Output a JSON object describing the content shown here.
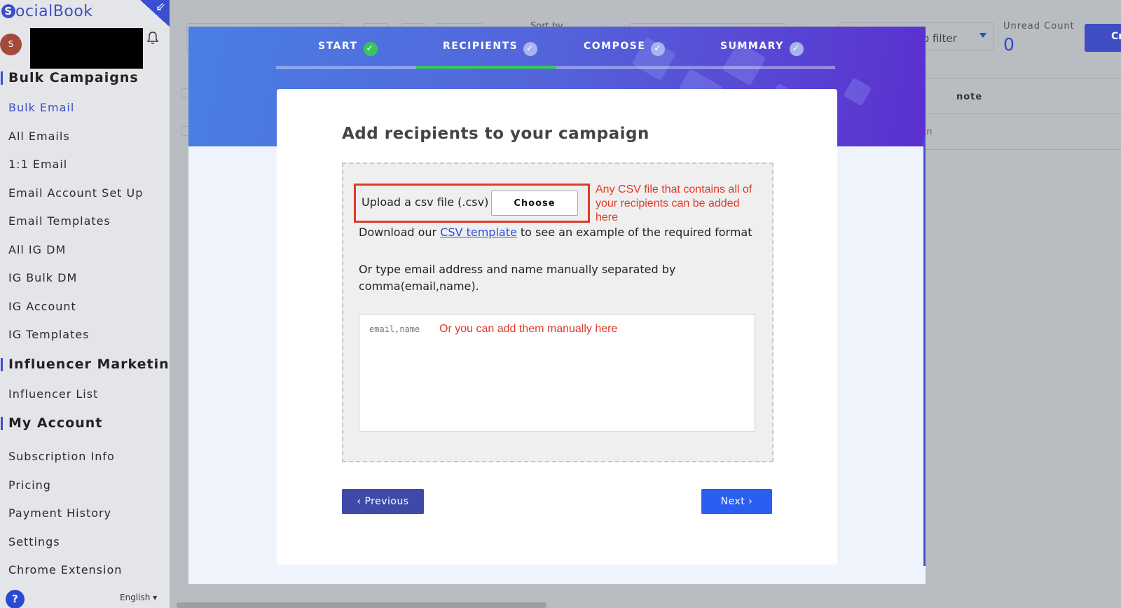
{
  "sidebar": {
    "logo_text": "ocialBook",
    "logo_mark": "S",
    "avatar_initial": "S",
    "sections": [
      {
        "header": "Bulk Campaigns",
        "items": [
          "Bulk Email",
          "All Emails",
          "1:1 Email",
          "Email Account Set Up",
          "Email Templates",
          "All IG DM",
          "IG Bulk DM",
          "IG Account",
          "IG Templates"
        ]
      },
      {
        "header": "Influencer Marketing",
        "items": [
          "Influencer List"
        ]
      },
      {
        "header": "My Account",
        "items": [
          "Subscription Info",
          "Pricing",
          "Payment History",
          "Settings",
          "Chrome Extension"
        ]
      }
    ],
    "active_item": "Bulk Email",
    "help_label": "?",
    "language": "English ▾"
  },
  "background": {
    "sort_label": "Sort by",
    "filter_text": "o filter",
    "unread_label": "Unread Count",
    "unread_value": "0",
    "create_label": "Cr",
    "note_header": "note",
    "row_fragment": "gn"
  },
  "modal": {
    "steps": [
      {
        "label": "START",
        "done": true
      },
      {
        "label": "RECIPIENTS",
        "done": false
      },
      {
        "label": "COMPOSE",
        "done": false
      },
      {
        "label": "SUMMARY",
        "done": false
      }
    ],
    "active_step": "RECIPIENTS",
    "title": "Add recipients to your campaign",
    "upload_label": "Upload a csv file (.csv)",
    "choose_label": "Choose",
    "annotation_upload": "Any CSV file that contains all of your recipients can be added here",
    "download_prefix": "Download our ",
    "download_link": "CSV template",
    "download_suffix": " to see an example of the required format",
    "manual_text": "Or type email address and name manually separated by comma(email,name).",
    "manual_placeholder": "email,name",
    "annotation_manual": "Or you can add them manually here",
    "previous_label": "‹ Previous",
    "next_label": "Next ›"
  },
  "colors": {
    "brand": "#3f4ec4",
    "annotation": "#e03a28",
    "step_done": "#38c75c",
    "next_button": "#2a5ef0",
    "previous_button": "#3f4aa8"
  }
}
